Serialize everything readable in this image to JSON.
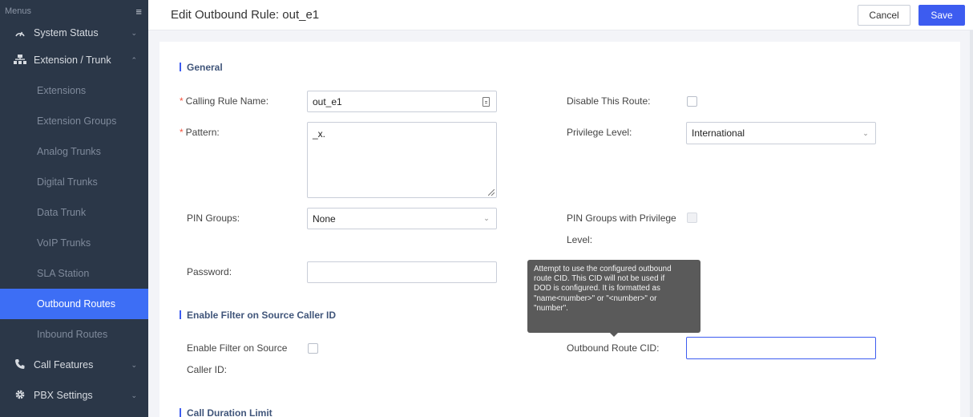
{
  "sidebar": {
    "header": "Menus",
    "items": [
      {
        "label": "System Status",
        "icon": "gauge-icon"
      },
      {
        "label": "Extension / Trunk",
        "icon": "network-icon"
      },
      {
        "label": "Call Features",
        "icon": "phone-icon"
      },
      {
        "label": "PBX Settings",
        "icon": "gear-icon"
      }
    ],
    "subitems": [
      "Extensions",
      "Extension Groups",
      "Analog Trunks",
      "Digital Trunks",
      "Data Trunk",
      "VoIP Trunks",
      "SLA Station",
      "Outbound Routes",
      "Inbound Routes"
    ],
    "active_subitem": "Outbound Routes"
  },
  "topbar": {
    "title": "Edit Outbound Rule: out_e1",
    "cancel_label": "Cancel",
    "save_label": "Save"
  },
  "form": {
    "section_general": "General",
    "section_filter": "Enable Filter on Source Caller ID",
    "section_duration": "Call Duration Limit",
    "calling_rule_name_label": "Calling Rule Name:",
    "calling_rule_name_value": "out_e1",
    "pattern_label": "Pattern:",
    "pattern_value": "_x.",
    "pin_groups_label": "PIN Groups:",
    "pin_groups_value": "None",
    "password_label": "Password:",
    "password_value": "",
    "disable_route_label": "Disable This Route:",
    "privilege_level_label": "Privilege Level:",
    "privilege_level_value": "International",
    "pin_groups_privilege_label_1": "PIN Groups with Privilege",
    "pin_groups_privilege_label_2": "Level:",
    "enable_filter_label_1": "Enable Filter on Source",
    "enable_filter_label_2": "Caller ID:",
    "outbound_cid_label": "Outbound Route CID:",
    "outbound_cid_value": ""
  },
  "tooltip": {
    "line1": "Attempt to use the configured outbound",
    "line2": "route CID. This CID will not be used if",
    "line3": "DOD is configured. It is formatted as",
    "line4": "\"name<number>\" or \"<number>\" or",
    "line5": "\"number\"."
  },
  "colors": {
    "sidebar_bg": "#2b3748",
    "accent": "#3d5cf0",
    "active_item": "#3d6ef5",
    "required": "#f5543f"
  }
}
